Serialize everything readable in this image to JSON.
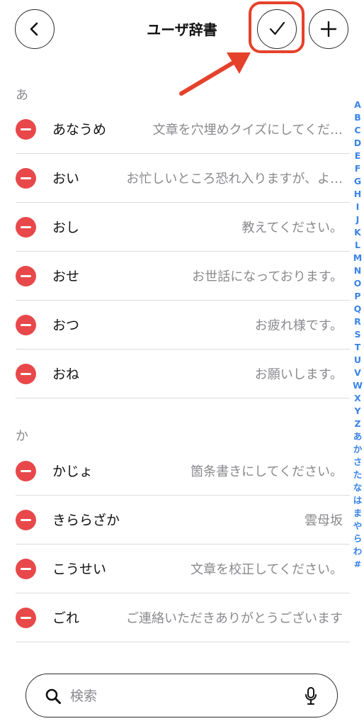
{
  "header": {
    "title": "ユーザ辞書",
    "back_icon": "chevron-left-icon",
    "done_icon": "checkmark-icon",
    "add_icon": "plus-icon",
    "highlight_color": "#e5412b"
  },
  "sections": [
    {
      "header": "あ",
      "entries": [
        {
          "reading": "あなうめ",
          "phrase": "文章を穴埋めクイズにしてくだ…"
        },
        {
          "reading": "おい",
          "phrase": "お忙しいところ恐れ入りますが、よ…"
        },
        {
          "reading": "おし",
          "phrase": "教えてください。"
        },
        {
          "reading": "おせ",
          "phrase": "お世話になっております。"
        },
        {
          "reading": "おつ",
          "phrase": "お疲れ様です。"
        },
        {
          "reading": "おね",
          "phrase": "お願いします。"
        }
      ]
    },
    {
      "header": "か",
      "entries": [
        {
          "reading": "かじょ",
          "phrase": "箇条書きにしてください。"
        },
        {
          "reading": "きららざか",
          "phrase": "雲母坂"
        },
        {
          "reading": "こうせい",
          "phrase": "文章を校正してください。"
        },
        {
          "reading": "ごれ",
          "phrase": "ご連絡いただきありがとうございます"
        }
      ]
    }
  ],
  "index_letters": [
    "A",
    "B",
    "C",
    "D",
    "E",
    "F",
    "G",
    "H",
    "I",
    "J",
    "K",
    "L",
    "M",
    "N",
    "O",
    "P",
    "Q",
    "R",
    "S",
    "T",
    "U",
    "V",
    "W",
    "X",
    "Y",
    "Z",
    "あ",
    "か",
    "さ",
    "た",
    "な",
    "は",
    "ま",
    "や",
    "ら",
    "わ",
    "#"
  ],
  "search": {
    "placeholder": "検索",
    "value": ""
  },
  "colors": {
    "delete": "#e8484a",
    "index": "#3a84e8",
    "secondary_text": "#8a8a8e"
  }
}
